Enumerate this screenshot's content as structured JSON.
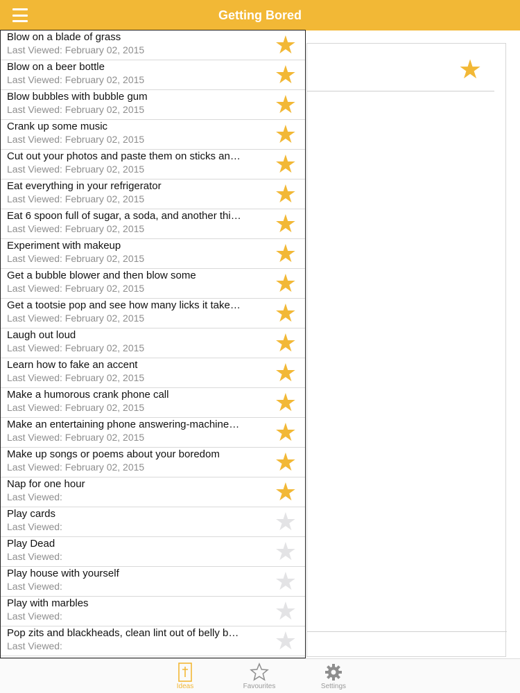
{
  "app": {
    "title": "Getting Bored",
    "accent_color": "#f2b836"
  },
  "list": {
    "items": [
      {
        "title": "Blow on a blade of grass",
        "sub": "Last Viewed: February 02, 2015",
        "favourite": true
      },
      {
        "title": "Blow on a beer bottle",
        "sub": "Last Viewed: February 02, 2015",
        "favourite": true
      },
      {
        "title": "Blow bubbles with bubble gum",
        "sub": "Last Viewed: February 02, 2015",
        "favourite": true
      },
      {
        "title": "Crank up some music",
        "sub": "Last Viewed: February 02, 2015",
        "favourite": true
      },
      {
        "title": "Cut out your photos and paste them on sticks an…",
        "sub": "Last Viewed: February 02, 2015",
        "favourite": true
      },
      {
        "title": "Eat everything in your refrigerator",
        "sub": "Last Viewed: February 02, 2015",
        "favourite": true
      },
      {
        "title": "Eat 6 spoon full of sugar, a soda, and another thi…",
        "sub": "Last Viewed: February 02, 2015",
        "favourite": true
      },
      {
        "title": "Experiment with makeup",
        "sub": "Last Viewed: February 02, 2015",
        "favourite": true
      },
      {
        "title": "Get a bubble blower and then blow some",
        "sub": "Last Viewed: February 02, 2015",
        "favourite": true
      },
      {
        "title": "Get a tootsie pop and see how many licks it take…",
        "sub": "Last Viewed: February 02, 2015",
        "favourite": true
      },
      {
        "title": "Laugh out loud",
        "sub": "Last Viewed: February 02, 2015",
        "favourite": true
      },
      {
        "title": "Learn how to fake an accent",
        "sub": "Last Viewed: February 02, 2015",
        "favourite": true
      },
      {
        "title": "Make a humorous crank phone call",
        "sub": "Last Viewed: February 02, 2015",
        "favourite": true
      },
      {
        "title": "Make an entertaining phone answering-machine…",
        "sub": "Last Viewed: February 02, 2015",
        "favourite": true
      },
      {
        "title": "Make up songs or poems about your boredom",
        "sub": "Last Viewed: February 02, 2015",
        "favourite": true
      },
      {
        "title": "Nap for one hour",
        "sub": "Last Viewed:",
        "favourite": true
      },
      {
        "title": "Play cards",
        "sub": "Last Viewed:",
        "favourite": false
      },
      {
        "title": "Play Dead",
        "sub": "Last Viewed:",
        "favourite": false
      },
      {
        "title": "Play house with yourself",
        "sub": "Last Viewed:",
        "favourite": false
      },
      {
        "title": "Play with marbles",
        "sub": "Last Viewed:",
        "favourite": false
      },
      {
        "title": "Pop zits and blackheads, clean lint out of belly b…",
        "sub": "Last Viewed:",
        "favourite": false
      }
    ]
  },
  "detail": {
    "favourite": true
  },
  "tabs": [
    {
      "label": "Ideas",
      "icon": "ideas-icon",
      "active": true
    },
    {
      "label": "Favourites",
      "icon": "star-outline-icon",
      "active": false
    },
    {
      "label": "Settings",
      "icon": "gear-icon",
      "active": false
    }
  ]
}
